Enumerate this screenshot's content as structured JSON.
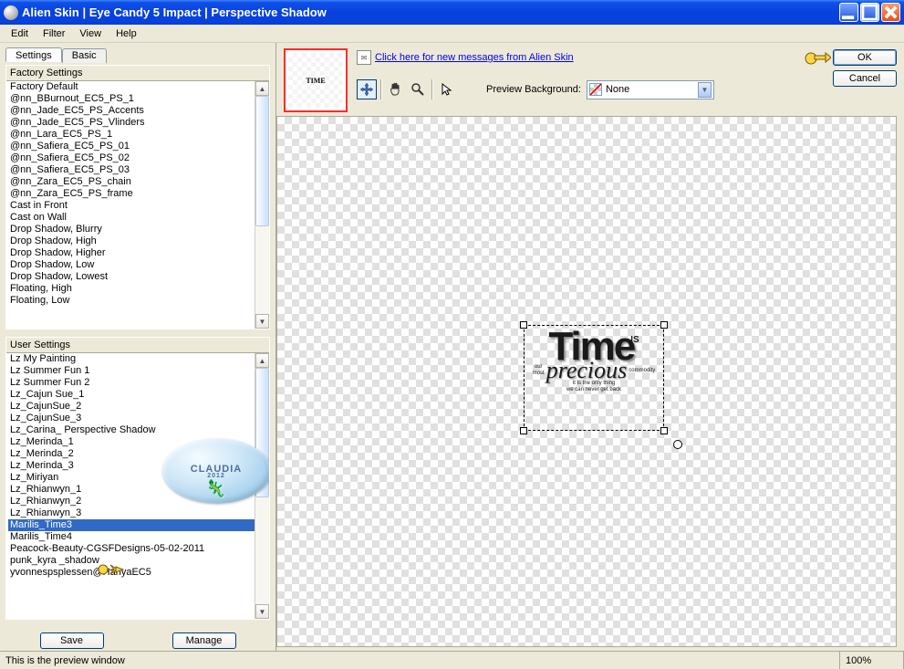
{
  "window": {
    "title": "Alien Skin  |  Eye Candy 5 Impact  |  Perspective Shadow"
  },
  "menu": {
    "edit": "Edit",
    "filter": "Filter",
    "view": "View",
    "help": "Help"
  },
  "tabs": {
    "settings": "Settings",
    "basic": "Basic"
  },
  "factory": {
    "header": "Factory Settings",
    "items": [
      "Factory Default",
      "@nn_BBurnout_EC5_PS_1",
      "@nn_Jade_EC5_PS_Accents",
      "@nn_Jade_EC5_PS_Vlinders",
      "@nn_Lara_EC5_PS_1",
      "@nn_Safiera_EC5_PS_01",
      "@nn_Safiera_EC5_PS_02",
      "@nn_Safiera_EC5_PS_03",
      "@nn_Zara_EC5_PS_chain",
      "@nn_Zara_EC5_PS_frame",
      "Cast in Front",
      "Cast on Wall",
      "Drop Shadow, Blurry",
      "Drop Shadow, High",
      "Drop Shadow, Higher",
      "Drop Shadow, Low",
      "Drop Shadow, Lowest",
      "Floating, High",
      "Floating, Low"
    ]
  },
  "user": {
    "header": "User Settings",
    "items": [
      "Lz My Painting",
      "Lz Summer Fun 1",
      "Lz Summer Fun 2",
      "Lz_Cajun Sue_1",
      "Lz_CajunSue_2",
      "Lz_CajunSue_3",
      "Lz_Carina_ Perspective Shadow",
      "Lz_Merinda_1",
      "Lz_Merinda_2",
      "Lz_Merinda_3",
      "Lz_Miriyan",
      "Lz_Rhianwyn_1",
      "Lz_Rhianwyn_2",
      "Lz_Rhianwyn_3",
      "Marilis_Time3",
      "Marilis_Time4",
      "Peacock-Beauty-CGSFDesigns-05-02-2011",
      "punk_kyra _shadow",
      "yvonnespsplessen@HanyaEC5"
    ],
    "selected_index": 14
  },
  "buttons": {
    "save": "Save",
    "manage": "Manage",
    "ok": "OK",
    "cancel": "Cancel"
  },
  "messagebar": {
    "link": "Click here for new messages from Alien Skin"
  },
  "previewbg": {
    "label": "Preview Background:",
    "value": "None"
  },
  "watermark": {
    "name": "CLAUDIA",
    "year": "2012"
  },
  "artwork": {
    "time": "Time",
    "is": "IS",
    "ourmost": "our most",
    "precious": "precious",
    "commodity": "commodity",
    "line1": "It is the only thing",
    "line2": "we can never get back"
  },
  "thumb_text": "TIME",
  "status": {
    "text": "This is the preview window",
    "zoom": "100%"
  }
}
